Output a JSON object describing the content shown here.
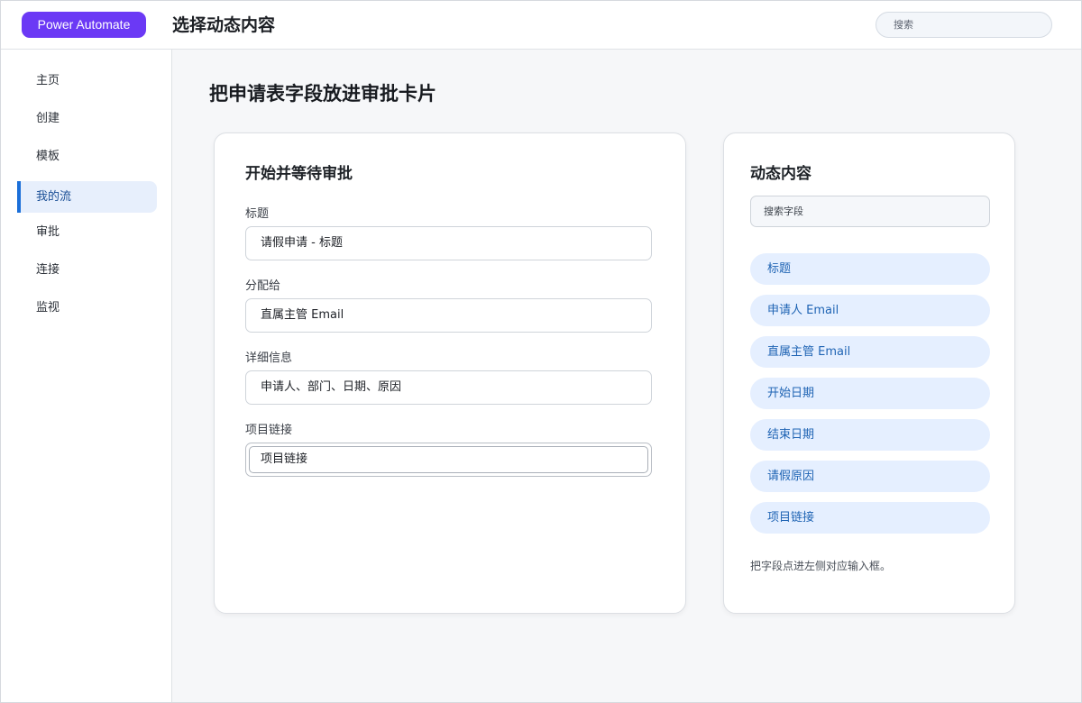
{
  "header": {
    "brand": "Power Automate",
    "title": "选择动态内容",
    "search_placeholder": "搜索"
  },
  "sidebar": {
    "items": [
      {
        "label": "主页",
        "active": false
      },
      {
        "label": "创建",
        "active": false
      },
      {
        "label": "模板",
        "active": false
      },
      {
        "label": "我的流",
        "active": true
      },
      {
        "label": "审批",
        "active": false
      },
      {
        "label": "连接",
        "active": false
      },
      {
        "label": "监视",
        "active": false
      }
    ]
  },
  "main": {
    "page_title": "把申请表字段放进审批卡片",
    "form": {
      "title": "开始并等待审批",
      "fields": [
        {
          "label": "标题",
          "value": "请假申请 - 标题"
        },
        {
          "label": "分配给",
          "value": "直属主管 Email"
        },
        {
          "label": "详细信息",
          "value": "申请人、部门、日期、原因"
        },
        {
          "label": "项目链接",
          "value": "项目链接"
        }
      ]
    },
    "dynamic": {
      "title": "动态内容",
      "search_placeholder": "搜索字段",
      "chips": [
        "标题",
        "申请人 Email",
        "直属主管 Email",
        "开始日期",
        "结束日期",
        "请假原因",
        "项目链接"
      ],
      "hint": "把字段点进左侧对应输入框。"
    }
  },
  "colors": {
    "brand": "#6b39f5",
    "accent": "#1b6fd9",
    "chip_bg": "#e5efff",
    "chip_text": "#1f64b4"
  }
}
